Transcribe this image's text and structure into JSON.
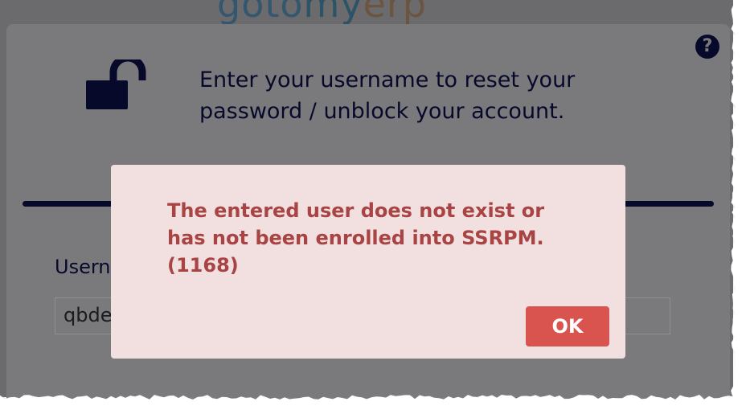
{
  "logo": {
    "part1": "goto",
    "part2": "my",
    "part3": "erp"
  },
  "panel": {
    "instruction_line1": "Enter your username to reset your",
    "instruction_line2": "password / unblock your account.",
    "help_icon": "?",
    "username_label": "Usern",
    "username_value": "qbde"
  },
  "dialog": {
    "message_line1": "The entered user does not exist or",
    "message_line2": "has not been enrolled into SSRPM.",
    "message_line3": "(1168)",
    "ok_label": "OK"
  },
  "icons": {
    "lock": "unlocked-padlock-icon",
    "help": "question-circle-icon"
  },
  "colors": {
    "overlay": "#6b6b6d",
    "panel": "#7a7a7c",
    "text_dark": "#07092a",
    "dialog_bg": "#f2dfe0",
    "error_text": "#a94445",
    "ok_button": "#d9534f"
  }
}
